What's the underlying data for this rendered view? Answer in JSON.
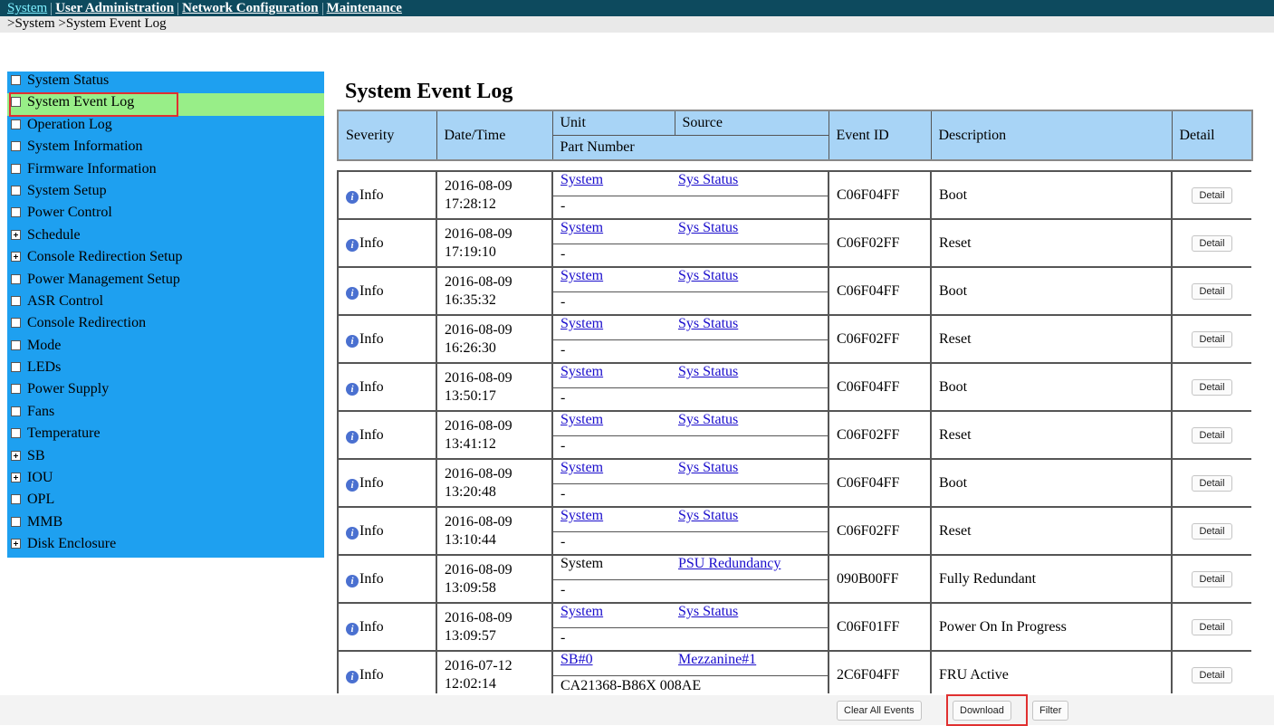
{
  "topnav": {
    "items": [
      "System",
      "User Administration",
      "Network Configuration",
      "Maintenance"
    ]
  },
  "breadcrumb": ">System >System Event Log",
  "sidebar": {
    "items": [
      {
        "label": "System Status",
        "expandable": false
      },
      {
        "label": "System Event Log",
        "expandable": false,
        "selected": true
      },
      {
        "label": "Operation Log",
        "expandable": false
      },
      {
        "label": "System Information",
        "expandable": false
      },
      {
        "label": "Firmware Information",
        "expandable": false
      },
      {
        "label": "System Setup",
        "expandable": false
      },
      {
        "label": "Power Control",
        "expandable": false
      },
      {
        "label": "Schedule",
        "expandable": true
      },
      {
        "label": "Console Redirection Setup",
        "expandable": true
      },
      {
        "label": "Power Management Setup",
        "expandable": false
      },
      {
        "label": "ASR Control",
        "expandable": false
      },
      {
        "label": "Console Redirection",
        "expandable": false
      },
      {
        "label": "Mode",
        "expandable": false
      },
      {
        "label": "LEDs",
        "expandable": false
      },
      {
        "label": "Power Supply",
        "expandable": false
      },
      {
        "label": "Fans",
        "expandable": false
      },
      {
        "label": "Temperature",
        "expandable": false
      },
      {
        "label": "SB",
        "expandable": true
      },
      {
        "label": "IOU",
        "expandable": true
      },
      {
        "label": "OPL",
        "expandable": false
      },
      {
        "label": "MMB",
        "expandable": false
      },
      {
        "label": "Disk Enclosure",
        "expandable": true
      }
    ]
  },
  "page_title": "System Event Log",
  "table": {
    "headers": {
      "severity": "Severity",
      "datetime": "Date/Time",
      "unit": "Unit",
      "source": "Source",
      "part_number": "Part Number",
      "event_id": "Event ID",
      "description": "Description",
      "detail": "Detail"
    },
    "rows": [
      {
        "severity": "Info",
        "date": "2016-08-09",
        "time": "17:28:12",
        "unit": "System",
        "unit_link": true,
        "source": "Sys Status",
        "part_number": "-",
        "event_id": "C06F04FF",
        "description": "Boot",
        "detail_label": "Detail"
      },
      {
        "severity": "Info",
        "date": "2016-08-09",
        "time": "17:19:10",
        "unit": "System",
        "unit_link": true,
        "source": "Sys Status",
        "part_number": "-",
        "event_id": "C06F02FF",
        "description": "Reset",
        "detail_label": "Detail"
      },
      {
        "severity": "Info",
        "date": "2016-08-09",
        "time": "16:35:32",
        "unit": "System",
        "unit_link": true,
        "source": "Sys Status",
        "part_number": "-",
        "event_id": "C06F04FF",
        "description": "Boot",
        "detail_label": "Detail"
      },
      {
        "severity": "Info",
        "date": "2016-08-09",
        "time": "16:26:30",
        "unit": "System",
        "unit_link": true,
        "source": "Sys Status",
        "part_number": "-",
        "event_id": "C06F02FF",
        "description": "Reset",
        "detail_label": "Detail"
      },
      {
        "severity": "Info",
        "date": "2016-08-09",
        "time": "13:50:17",
        "unit": "System",
        "unit_link": true,
        "source": "Sys Status",
        "part_number": "-",
        "event_id": "C06F04FF",
        "description": "Boot",
        "detail_label": "Detail"
      },
      {
        "severity": "Info",
        "date": "2016-08-09",
        "time": "13:41:12",
        "unit": "System",
        "unit_link": true,
        "source": "Sys Status",
        "part_number": "-",
        "event_id": "C06F02FF",
        "description": "Reset",
        "detail_label": "Detail"
      },
      {
        "severity": "Info",
        "date": "2016-08-09",
        "time": "13:20:48",
        "unit": "System",
        "unit_link": true,
        "source": "Sys Status",
        "part_number": "-",
        "event_id": "C06F04FF",
        "description": "Boot",
        "detail_label": "Detail"
      },
      {
        "severity": "Info",
        "date": "2016-08-09",
        "time": "13:10:44",
        "unit": "System",
        "unit_link": true,
        "source": "Sys Status",
        "part_number": "-",
        "event_id": "C06F02FF",
        "description": "Reset",
        "detail_label": "Detail"
      },
      {
        "severity": "Info",
        "date": "2016-08-09",
        "time": "13:09:58",
        "unit": "System",
        "unit_link": false,
        "source": "PSU Redundancy",
        "part_number": "-",
        "event_id": "090B00FF",
        "description": "Fully Redundant",
        "detail_label": "Detail"
      },
      {
        "severity": "Info",
        "date": "2016-08-09",
        "time": "13:09:57",
        "unit": "System",
        "unit_link": true,
        "source": "Sys Status",
        "part_number": "-",
        "event_id": "C06F01FF",
        "description": "Power On In Progress",
        "detail_label": "Detail"
      },
      {
        "severity": "Info",
        "date": "2016-07-12",
        "time": "12:02:14",
        "unit": "SB#0",
        "unit_link": true,
        "source": "Mezzanine#1",
        "part_number": "CA21368-B86X 008AE",
        "event_id": "2C6F04FF",
        "description": "FRU Active",
        "detail_label": "Detail"
      }
    ]
  },
  "footer": {
    "clear_label": "Clear All Events",
    "download_label": "Download",
    "filter_label": "Filter"
  },
  "colors": {
    "topnav_bg": "#0d4a5e",
    "sidebar_bg": "#1ea0f0",
    "sidebar_selected": "#98ee88",
    "header_bg": "#a8d4f6",
    "link": "#1a0dcc",
    "highlight_outline": "#e03030"
  }
}
